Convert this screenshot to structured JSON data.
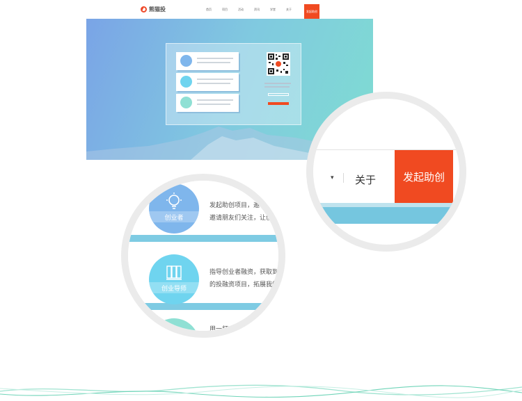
{
  "site": {
    "logo_text": "熊猫投",
    "nav_items": [
      "首页",
      "项目",
      "活动",
      "资讯",
      "学堂",
      "关于"
    ],
    "nav_cta": "发起助创"
  },
  "zoom_header": {
    "about_label": "关于",
    "cta_label": "发起助创"
  },
  "zoom_cards": {
    "cards": [
      {
        "badge": "创业者",
        "line1": "发起助创项目，邀",
        "line2": "邀请朋友们关注，让创"
      },
      {
        "badge": "创业导师",
        "line1": "指导创业者融资，获取到",
        "line2": "的投融资项目，拓展我的"
      },
      {
        "badge": "",
        "line1": "用一杯",
        "line2": ""
      }
    ]
  },
  "colors": {
    "accent_red": "#f04a21",
    "hero_blue": "#7aa4e6",
    "hero_teal": "#7fdcd2",
    "badge_blue": "#7fb6ec",
    "badge_cyan": "#6fd4ef",
    "badge_mint": "#8fe0d4"
  }
}
